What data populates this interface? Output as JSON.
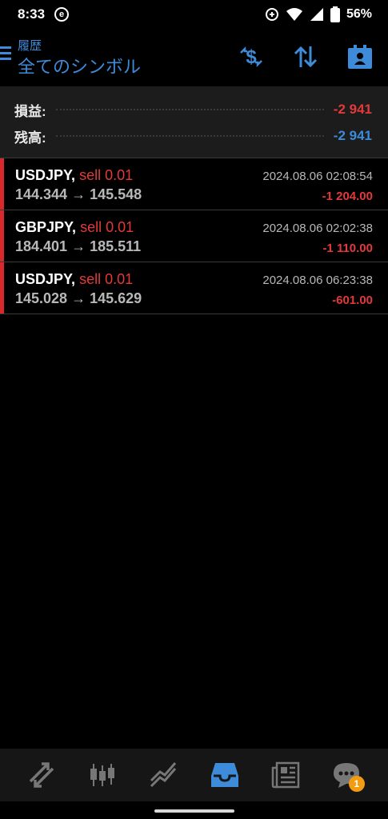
{
  "status_bar": {
    "time": "8:33",
    "app_badge": "e",
    "battery": "56%",
    "icons": [
      "sync-icon",
      "wifi-icon",
      "signal-icon",
      "battery-icon"
    ]
  },
  "header": {
    "subtitle": "履歴",
    "title": "全てのシンボル",
    "actions": [
      "dollar-swap-icon",
      "sort-arrows-icon",
      "account-id-icon"
    ]
  },
  "summary": {
    "profit_label": "損益:",
    "profit_value": "-2 941",
    "balance_label": "残高:",
    "balance_value": "-2 941"
  },
  "deals": [
    {
      "symbol": "USDJPY,",
      "side": "sell 0.01",
      "prices": "144.344 → 145.548",
      "time": "2024.08.06 02:08:54",
      "profit": "-1 204.00"
    },
    {
      "symbol": "GBPJPY,",
      "side": "sell 0.01",
      "prices": "184.401 → 185.511",
      "time": "2024.08.06 02:02:38",
      "profit": "-1 110.00"
    },
    {
      "symbol": "USDJPY,",
      "side": "sell 0.01",
      "prices": "145.028 → 145.629",
      "time": "2024.08.06 06:23:38",
      "profit": "-601.00"
    }
  ],
  "bottom_nav": {
    "items": [
      "quotes-icon",
      "chart-icon",
      "trade-icon",
      "history-icon",
      "news-icon",
      "chat-icon"
    ],
    "active": "history-icon",
    "chat_badge": "1"
  },
  "colors": {
    "accent": "#3d8bd9",
    "loss": "#e23a3a",
    "badge": "#f39c12"
  }
}
